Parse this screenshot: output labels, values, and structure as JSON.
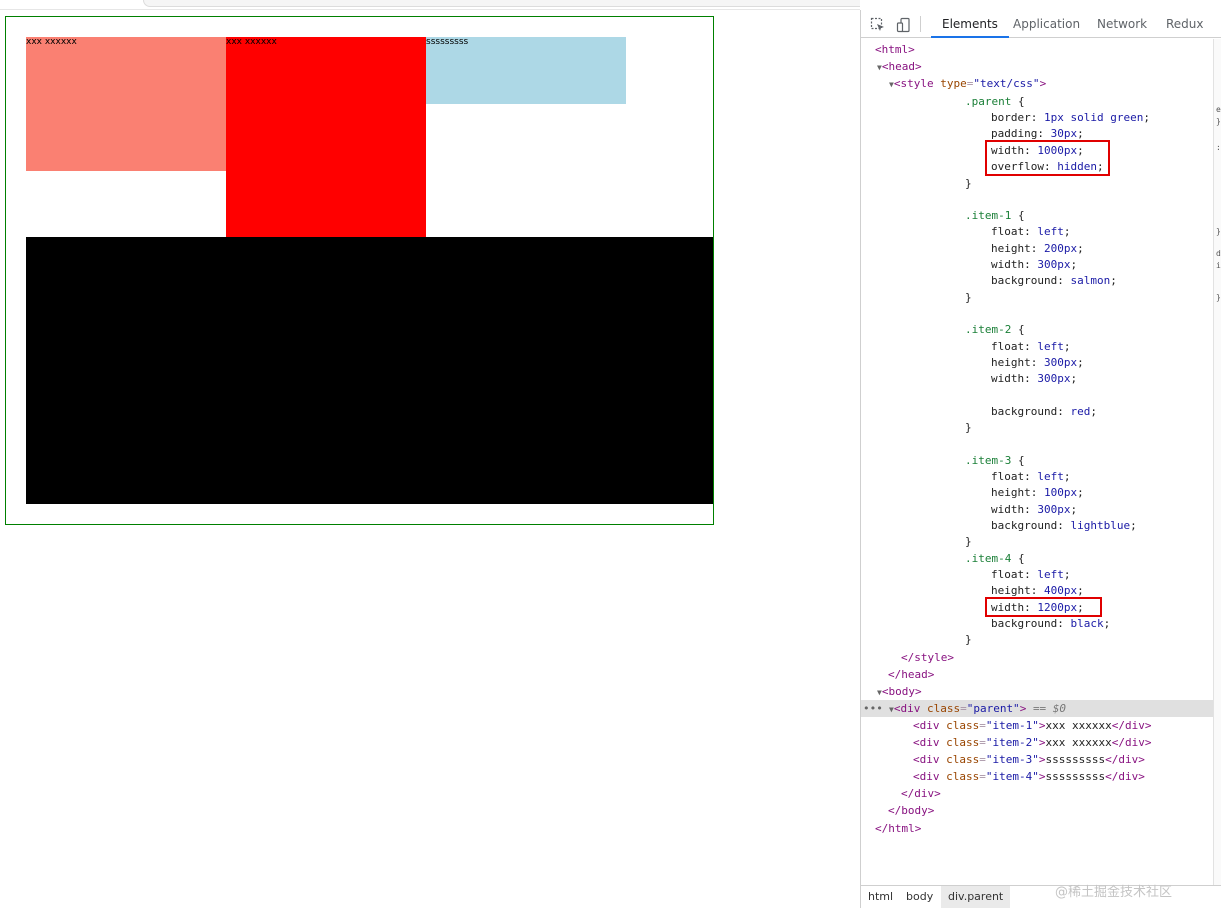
{
  "preview": {
    "items": [
      {
        "name": "item-1",
        "text": "xxx xxxxxx",
        "color": "#fa8072"
      },
      {
        "name": "item-2",
        "text": "xxx xxxxxx",
        "color": "#ff0000"
      },
      {
        "name": "item-3",
        "text": "sssssssss",
        "color": "#add8e6"
      },
      {
        "name": "item-4",
        "text": "sssssssss",
        "color": "#000000"
      }
    ],
    "parent_border_color": "#008000"
  },
  "devtools": {
    "tabs": [
      "Elements",
      "Application",
      "Network",
      "Redux"
    ],
    "active_tab": "Elements",
    "icons": [
      "inspect-element-icon",
      "device-toolbar-icon"
    ],
    "breadcrumbs": [
      "html",
      "body",
      "div.parent"
    ],
    "selected_marker": "== $0",
    "highlight_color": "#e00000",
    "side_glyphs": [
      "e",
      "}",
      ":",
      "}",
      "d",
      "i",
      "}"
    ]
  },
  "source": {
    "html_open": "<html>",
    "head_open": "<head>",
    "style_open_tag": "<style",
    "style_type_attr": "type",
    "style_type_val": "\"text/css\"",
    "rules": [
      {
        "selector": ".parent",
        "decls": [
          {
            "prop": "border",
            "val": "1px solid green"
          },
          {
            "prop": "padding",
            "val": "30px"
          },
          {
            "prop": "width",
            "val": "1000px"
          },
          {
            "prop": "overflow",
            "val": "hidden"
          }
        ]
      },
      {
        "selector": ".item-1",
        "decls": [
          {
            "prop": "float",
            "val": "left"
          },
          {
            "prop": "height",
            "val": "200px"
          },
          {
            "prop": "width",
            "val": "300px"
          },
          {
            "prop": "background",
            "val": "salmon"
          }
        ]
      },
      {
        "selector": ".item-2",
        "decls": [
          {
            "prop": "float",
            "val": "left"
          },
          {
            "prop": "height",
            "val": "300px"
          },
          {
            "prop": "width",
            "val": "300px"
          },
          {
            "prop": "background",
            "val": "red"
          }
        ]
      },
      {
        "selector": ".item-3",
        "decls": [
          {
            "prop": "float",
            "val": "left"
          },
          {
            "prop": "height",
            "val": "100px"
          },
          {
            "prop": "width",
            "val": "300px"
          },
          {
            "prop": "background",
            "val": "lightblue"
          }
        ]
      },
      {
        "selector": ".item-4",
        "decls": [
          {
            "prop": "float",
            "val": "left"
          },
          {
            "prop": "height",
            "val": "400px"
          },
          {
            "prop": "width",
            "val": "1200px"
          },
          {
            "prop": "background",
            "val": "black"
          }
        ]
      }
    ],
    "brace_open": "{",
    "brace_close": "}",
    "style_close": "</style>",
    "head_close": "</head>",
    "body_open": "<body>",
    "div_open": "<div",
    "class_attr": "class",
    "parent_class": "\"parent\"",
    "children": [
      {
        "cls": "\"item-1\"",
        "text": "xxx xxxxxx"
      },
      {
        "cls": "\"item-2\"",
        "text": "xxx xxxxxx"
      },
      {
        "cls": "\"item-3\"",
        "text": "sssssssss"
      },
      {
        "cls": "\"item-4\"",
        "text": "sssssssss"
      }
    ],
    "div_close": "</div>",
    "body_close": "</body>",
    "html_close": "</html>"
  },
  "watermark": "@稀土掘金技术社区"
}
